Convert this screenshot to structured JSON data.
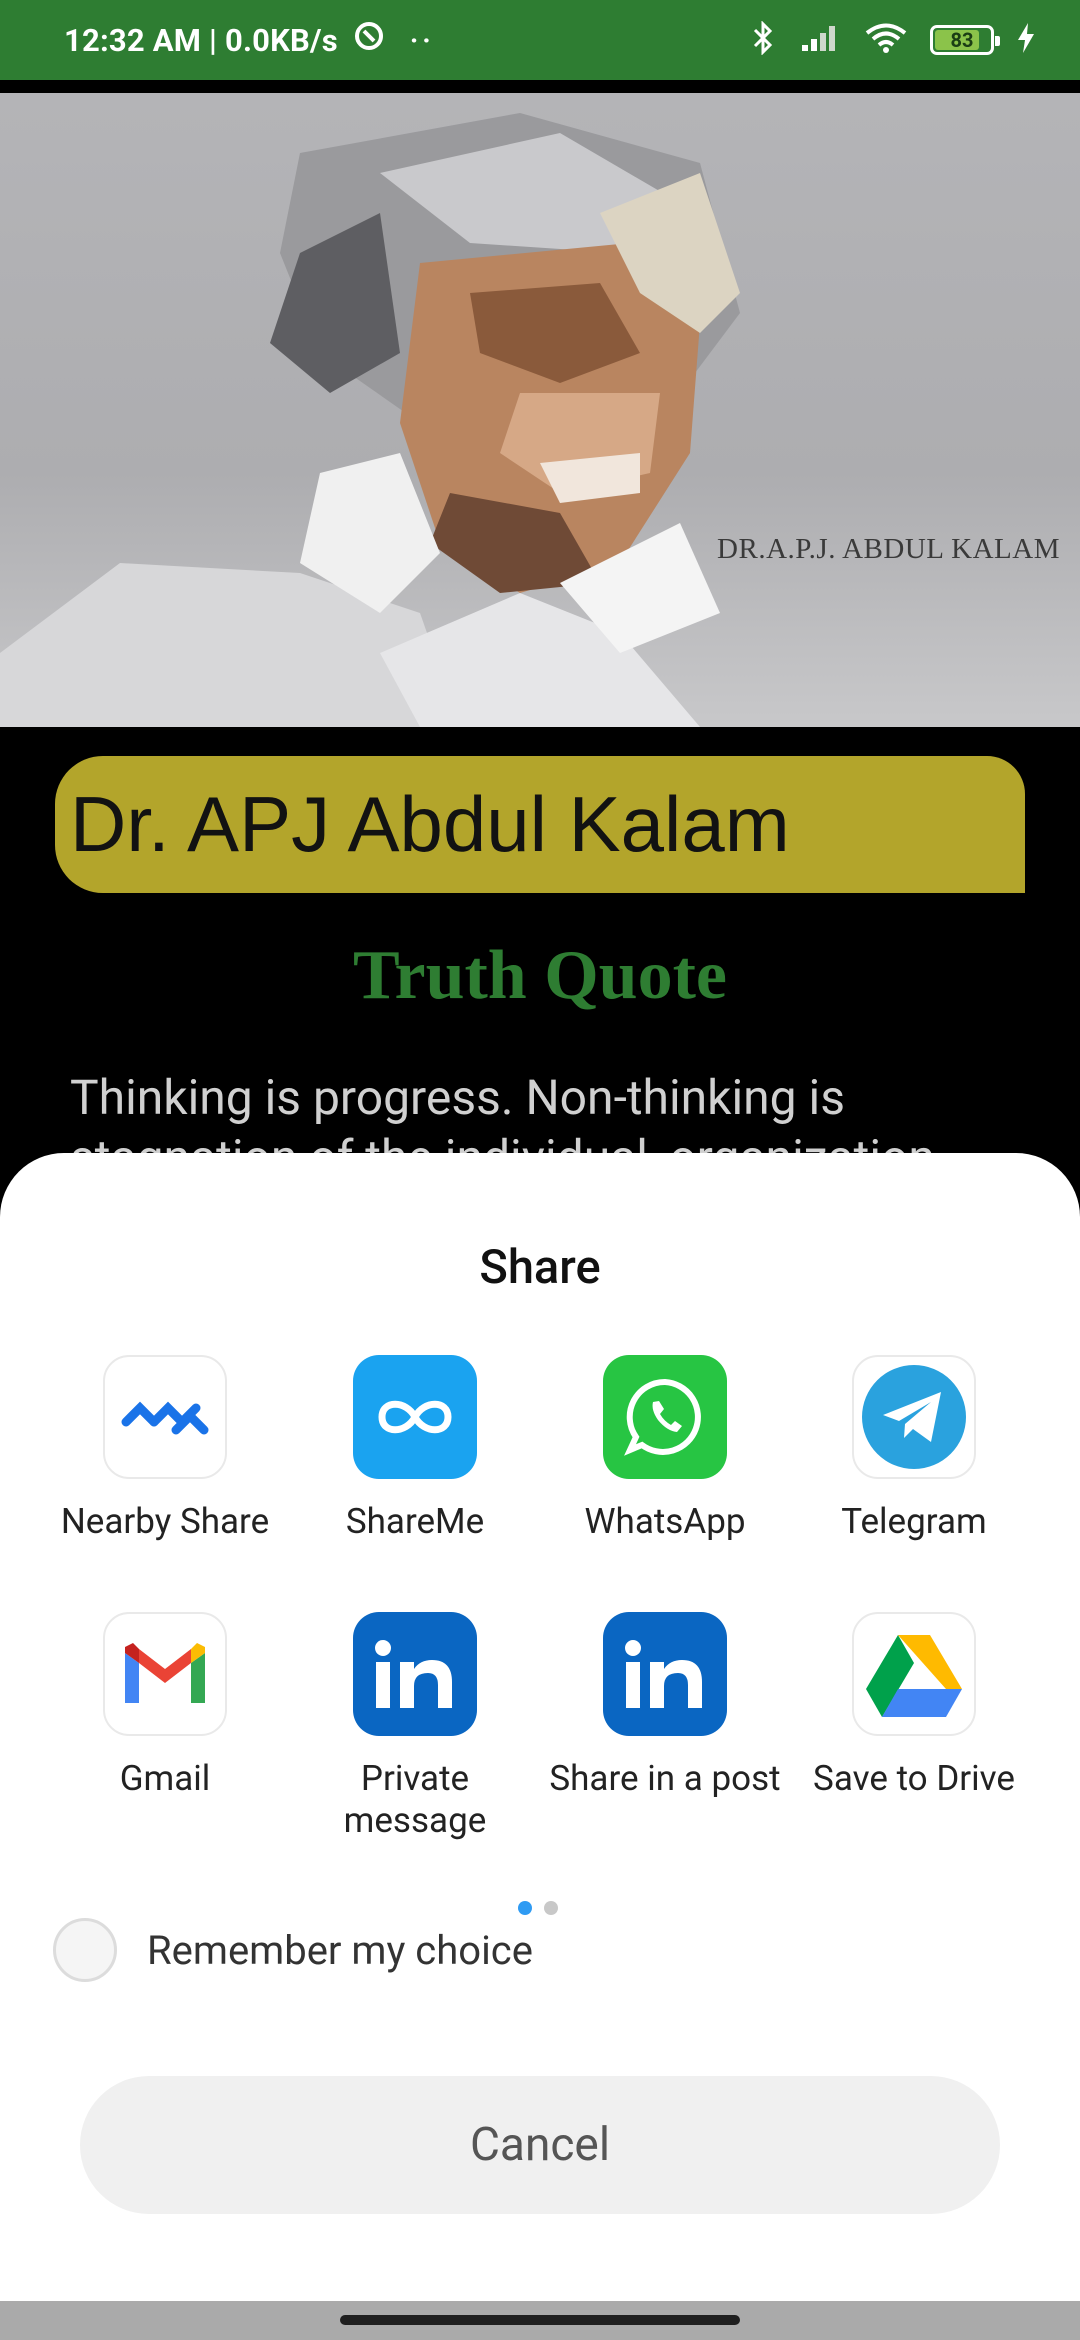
{
  "status_bar": {
    "time_speed": "12:32 AM | 0.0KB/s",
    "dots": "··",
    "battery_percent": "83",
    "battery_level": 0.83
  },
  "hero": {
    "portrait_caption": "DR.A.P.J. ABDUL KALAM"
  },
  "content": {
    "name": "Dr. APJ Abdul Kalam",
    "quote_type": "Truth Quote",
    "quote_text": "Thinking is progress. Non-thinking is stagnation of the individual, organization"
  },
  "share_sheet": {
    "title": "Share",
    "apps": [
      {
        "label": "Nearby Share",
        "icon": "nearby-share-icon"
      },
      {
        "label": "ShareMe",
        "icon": "shareme-icon"
      },
      {
        "label": "WhatsApp",
        "icon": "whatsapp-icon"
      },
      {
        "label": "Telegram",
        "icon": "telegram-icon"
      },
      {
        "label": "Gmail",
        "icon": "gmail-icon"
      },
      {
        "label": "Private message",
        "icon": "linkedin-icon"
      },
      {
        "label": "Share in a post",
        "icon": "linkedin-icon"
      },
      {
        "label": "Save to Drive",
        "icon": "google-drive-icon"
      }
    ],
    "page_count": 2,
    "current_page": 1,
    "remember_label": "Remember my choice",
    "remember_checked": false,
    "cancel_label": "Cancel"
  },
  "colors": {
    "status_bar": "#2e7d32",
    "name_banner": "#b3a52b",
    "quote_type": "#2e7d32",
    "page_indicator_active": "#2f9bf3"
  }
}
